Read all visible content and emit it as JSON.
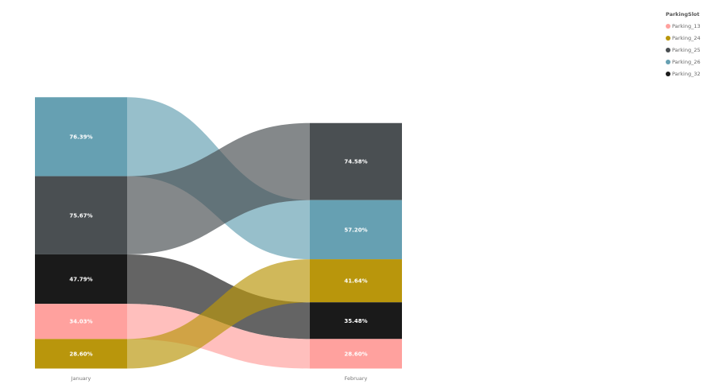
{
  "chart_data": {
    "type": "ribbon",
    "title": "",
    "legend": {
      "title": "ParkingSlot",
      "position": "top-right",
      "items": [
        {
          "name": "Parking_13",
          "color": "#FFA19E"
        },
        {
          "name": "Parking_24",
          "color": "#B9960C"
        },
        {
          "name": "Parking_25",
          "color": "#4A4F52"
        },
        {
          "name": "Parking_26",
          "color": "#66A0B2"
        },
        {
          "name": "Parking_32",
          "color": "#1A1A1A"
        }
      ]
    },
    "categories": [
      "January",
      "February"
    ],
    "columns": [
      {
        "category": "January",
        "segments": [
          {
            "series": "Parking_26",
            "value": 76.39,
            "label": "76.39%"
          },
          {
            "series": "Parking_25",
            "value": 75.67,
            "label": "75.67%"
          },
          {
            "series": "Parking_32",
            "value": 47.79,
            "label": "47.79%"
          },
          {
            "series": "Parking_13",
            "value": 34.03,
            "label": "34.03%"
          },
          {
            "series": "Parking_24",
            "value": 28.6,
            "label": "28.60%"
          }
        ]
      },
      {
        "category": "February",
        "segments": [
          {
            "series": "Parking_25",
            "value": 74.58,
            "label": "74.58%"
          },
          {
            "series": "Parking_26",
            "value": 57.2,
            "label": "57.20%"
          },
          {
            "series": "Parking_24",
            "value": 41.64,
            "label": "41.64%"
          },
          {
            "series": "Parking_32",
            "value": 35.48,
            "label": "35.48%"
          },
          {
            "series": "Parking_13",
            "value": 28.6,
            "label": "28.60%"
          }
        ]
      }
    ]
  }
}
